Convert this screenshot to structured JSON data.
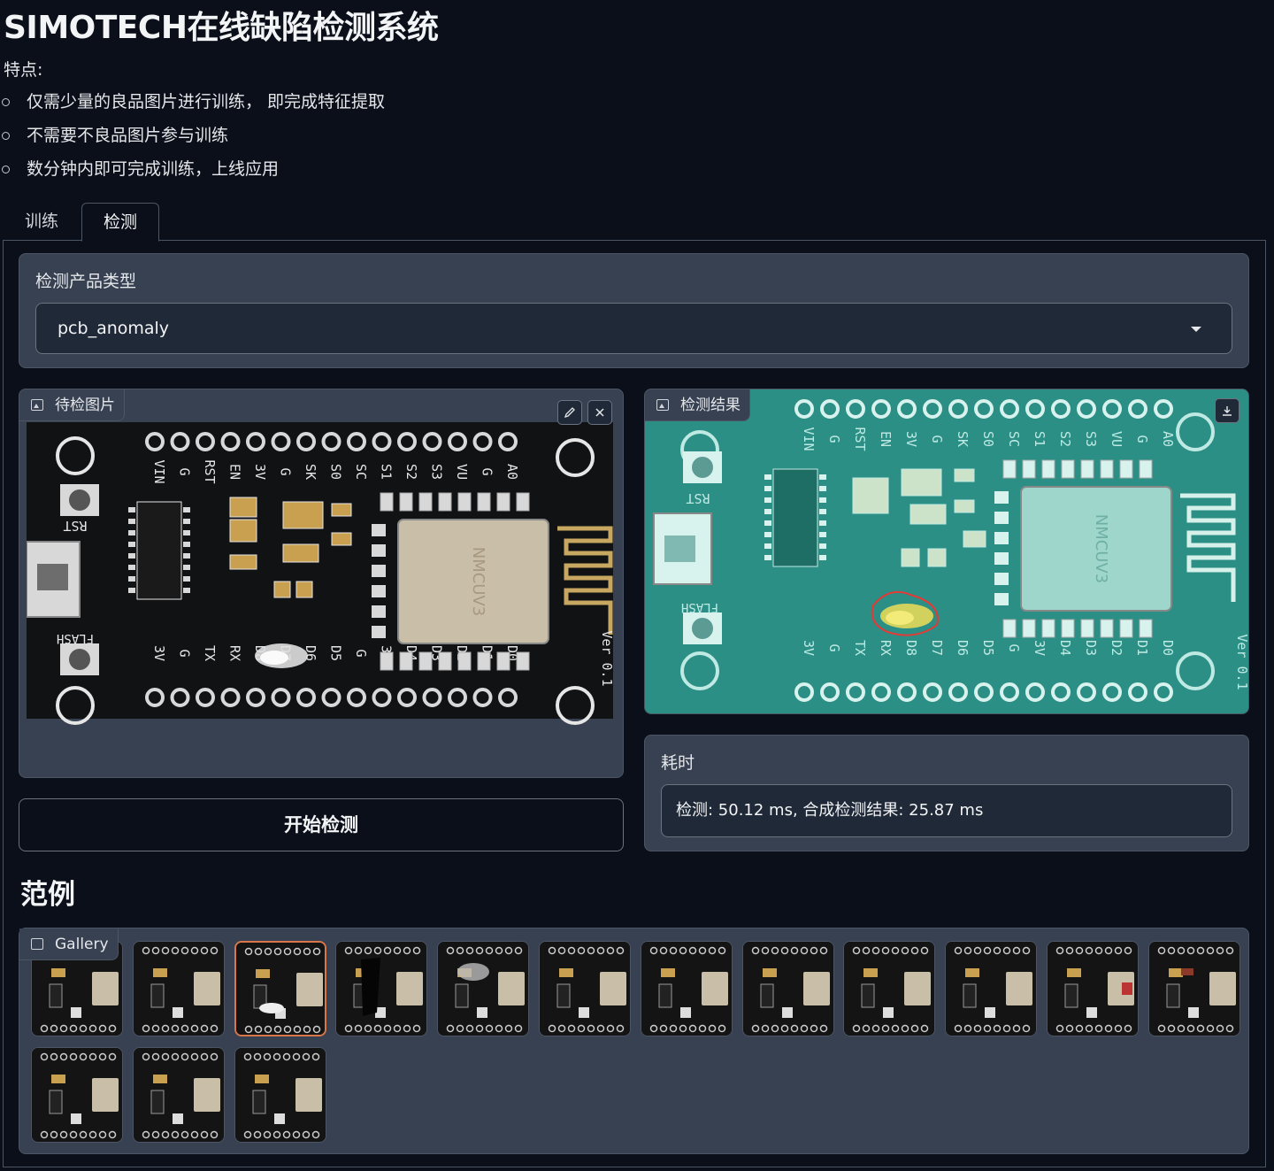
{
  "app": {
    "title": "SIMOTECH在线缺陷检测系统",
    "features_label": "特点:",
    "features": [
      "仅需少量的良品图片进行训练， 即完成特征提取",
      "不需要不良品图片参与训练",
      "数分钟内即可完成训练，上线应用"
    ]
  },
  "tabs": [
    {
      "label": "训练",
      "active": false
    },
    {
      "label": "检测",
      "active": true
    }
  ],
  "product_type": {
    "label": "检测产品类型",
    "value": "pcb_anomaly"
  },
  "input_image": {
    "label": "待检图片",
    "edit_icon": "pencil-icon",
    "clear_icon": "close-icon"
  },
  "output_image": {
    "label": "检测结果",
    "download_icon": "download-icon"
  },
  "start_button": "开始检测",
  "timing": {
    "label": "耗时",
    "value": "检测: 50.12 ms, 合成检测结果: 25.87 ms"
  },
  "examples": {
    "title": "范例",
    "gallery_label": "Gallery",
    "selected_index": 2,
    "count": 15
  },
  "pcb_text": {
    "top_pins": [
      "VIN",
      "G",
      "RST",
      "EN",
      "3V",
      "G",
      "SK",
      "S0",
      "SC",
      "S1",
      "S2",
      "S3",
      "VU",
      "G",
      "A0"
    ],
    "bottom_pins": [
      "3V",
      "G",
      "TX",
      "RX",
      "D8",
      "D7",
      "D6",
      "D5",
      "G",
      "3V",
      "D4",
      "D3",
      "D2",
      "D1",
      "D0"
    ],
    "rst": "RST",
    "flash": "FLASH",
    "ver": "Ver 0.1",
    "chip": "NMCUV3"
  },
  "colors": {
    "background": "#0b0f19",
    "block": "#374151",
    "border": "#4b5563",
    "selected_border": "#d9774a",
    "defect_outline": "#e53935"
  }
}
